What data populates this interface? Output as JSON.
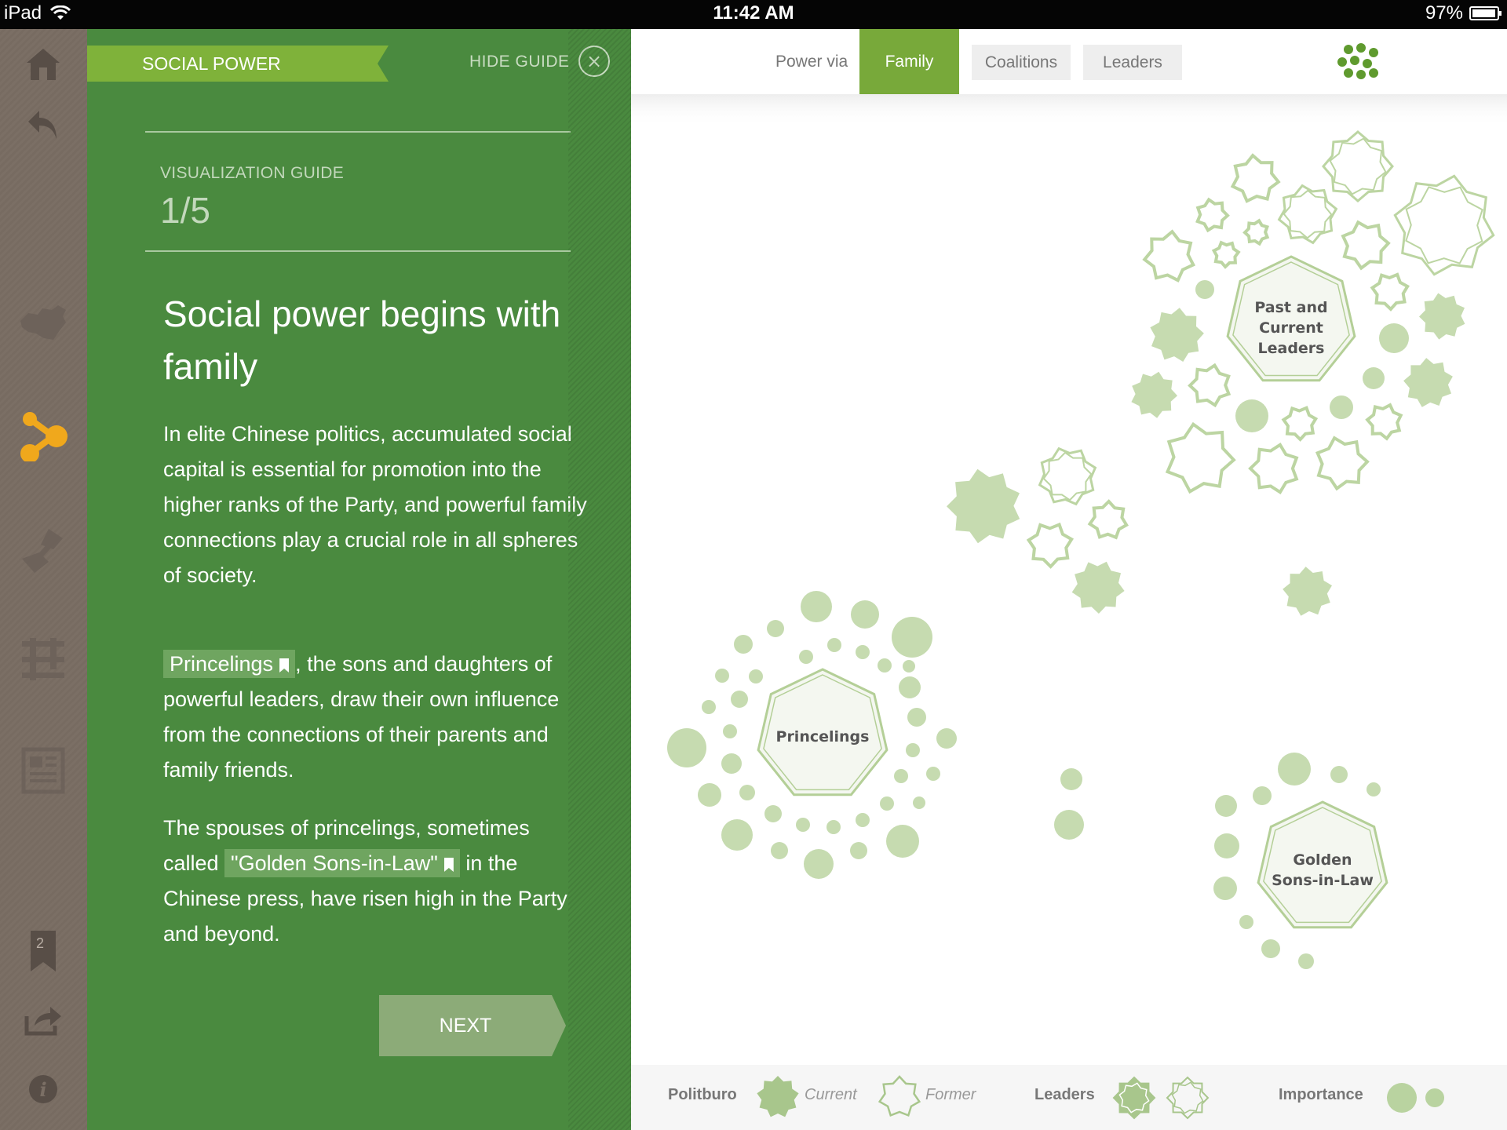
{
  "status_bar": {
    "device": "iPad",
    "time": "11:42 AM",
    "battery": "97%"
  },
  "rail": {
    "bookmark_count": "2"
  },
  "guide": {
    "section": "SOCIAL POWER",
    "hide_label": "HIDE GUIDE",
    "close_glyph": "×",
    "label": "VISUALIZATION GUIDE",
    "step": "1/5",
    "title": "Social power begins with family",
    "p1": "In elite Chinese politics, accumulated social capital is essential for promotion into the higher ranks of the Party, and powerful family connections play a crucial role in all spheres of society.",
    "p2_chip": "Princelings",
    "p2_rest": ", the sons and daughters of powerful leaders, draw their own influence from the connections of their parents and family friends.",
    "p3_start": "The spouses of princelings, sometimes called ",
    "p3_chip": "\"Golden Sons-in-Law\"",
    "p3_end": " in the Chinese press, have risen high in the Party and beyond.",
    "next_label": "NEXT"
  },
  "tabs": {
    "caption": "Power via",
    "active": "Family",
    "items": [
      "Coalitions",
      "Leaders"
    ]
  },
  "clusters": {
    "leaders_line1": "Past and",
    "leaders_line2": "Current",
    "leaders_line3": "Leaders",
    "princelings": "Princelings",
    "sons_line1": "Golden",
    "sons_line2": "Sons-in-Law"
  },
  "legend": {
    "politburo": "Politburo",
    "current": "Current",
    "former": "Former",
    "leaders": "Leaders",
    "importance": "Importance"
  },
  "colors": {
    "guide_green": "#4a8a3f",
    "ribbon_green": "#7fb23a",
    "active_tab": "#78a93a",
    "node_fill": "#c5d9b0",
    "node_stroke": "#b7d09c",
    "rail": "#7b6f65",
    "accent_orange": "#f0a81c"
  }
}
